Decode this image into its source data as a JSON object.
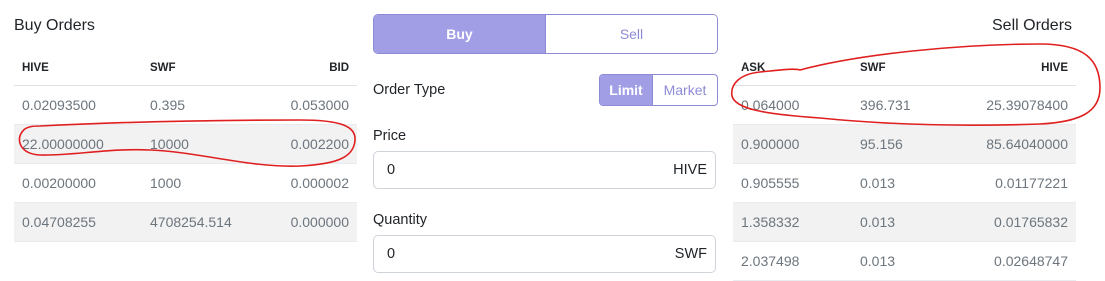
{
  "buy_orders": {
    "title": "Buy Orders",
    "headers": [
      "HIVE",
      "SWF",
      "BID"
    ],
    "rows": [
      [
        "0.02093500",
        "0.395",
        "0.053000"
      ],
      [
        "22.00000000",
        "10000",
        "0.002200"
      ],
      [
        "0.00200000",
        "1000",
        "0.000002"
      ],
      [
        "0.04708255",
        "4708254.514",
        "0.000000"
      ]
    ]
  },
  "order_form": {
    "buy_label": "Buy",
    "sell_label": "Sell",
    "order_type_label": "Order Type",
    "limit_label": "Limit",
    "market_label": "Market",
    "price_label": "Price",
    "price_value": "0",
    "price_unit": "HIVE",
    "quantity_label": "Quantity",
    "quantity_value": "0",
    "quantity_unit": "SWF"
  },
  "sell_orders": {
    "title": "Sell Orders",
    "headers": [
      "ASK",
      "SWF",
      "HIVE"
    ],
    "rows": [
      [
        "0.064000",
        "396.731",
        "25.39078400"
      ],
      [
        "0.900000",
        "95.156",
        "85.64040000"
      ],
      [
        "0.905555",
        "0.013",
        "0.01177221"
      ],
      [
        "1.358332",
        "0.013",
        "0.01765832"
      ],
      [
        "2.037498",
        "0.013",
        "0.02648747"
      ]
    ]
  },
  "colors": {
    "accent": "#a19ee6",
    "accent_border": "#8e8bd6",
    "annotation": "#e02020"
  }
}
